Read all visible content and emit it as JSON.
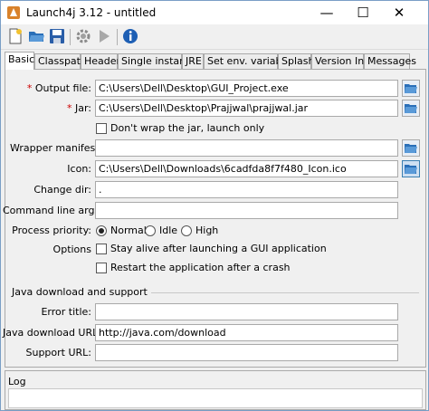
{
  "window": {
    "title": "Launch4j 3.12 - untitled",
    "controls": {
      "minimize": "—",
      "maximize": "☐",
      "close": "✕"
    }
  },
  "toolbar": {
    "icons": [
      "new-file-icon",
      "open-folder-icon",
      "save-icon",
      "gear-icon",
      "run-icon",
      "info-icon"
    ]
  },
  "tabs": [
    {
      "label": "Basic",
      "active": true
    },
    {
      "label": "Classpath"
    },
    {
      "label": "Header"
    },
    {
      "label": "Single instance"
    },
    {
      "label": "JRE"
    },
    {
      "label": "Set env. variables"
    },
    {
      "label": "Splash"
    },
    {
      "label": "Version Info"
    },
    {
      "label": "Messages"
    }
  ],
  "basic": {
    "output_file": {
      "required_mark": "*",
      "label": "Output file:",
      "value": "C:\\Users\\Dell\\Desktop\\GUI_Project.exe"
    },
    "jar": {
      "required_mark": "*",
      "label": "Jar:",
      "value": "C:\\Users\\Dell\\Desktop\\Prajjwal\\prajjwal.jar"
    },
    "dont_wrap": {
      "label": "Don't wrap the jar, launch only",
      "checked": false
    },
    "wrapper_manifest": {
      "label": "Wrapper manifest:",
      "value": ""
    },
    "icon": {
      "label": "Icon:",
      "value": "C:\\Users\\Dell\\Downloads\\6cadfda8f7f480_Icon.ico"
    },
    "change_dir": {
      "label": "Change dir:",
      "value": "."
    },
    "command_line_args": {
      "label": "Command line args:",
      "value": ""
    },
    "process_priority": {
      "label": "Process priority:",
      "options": [
        "Normal",
        "Idle",
        "High"
      ],
      "selected": "Normal"
    },
    "options": {
      "label": "Options",
      "stay_alive": {
        "label": "Stay alive after launching a GUI application",
        "checked": false
      },
      "restart": {
        "label": "Restart the application after a crash",
        "checked": false
      }
    }
  },
  "java_download": {
    "section_title": "Java download and support",
    "error_title": {
      "label": "Error title:",
      "value": ""
    },
    "download_url": {
      "label": "Java download URL:",
      "value": "http://java.com/download"
    },
    "support_url": {
      "label": "Support URL:",
      "value": ""
    }
  },
  "log": {
    "title": "Log",
    "content": ""
  },
  "colors": {
    "required": "#cc0000",
    "folder": "#2a6fb8",
    "info": "#1e5fb4"
  }
}
